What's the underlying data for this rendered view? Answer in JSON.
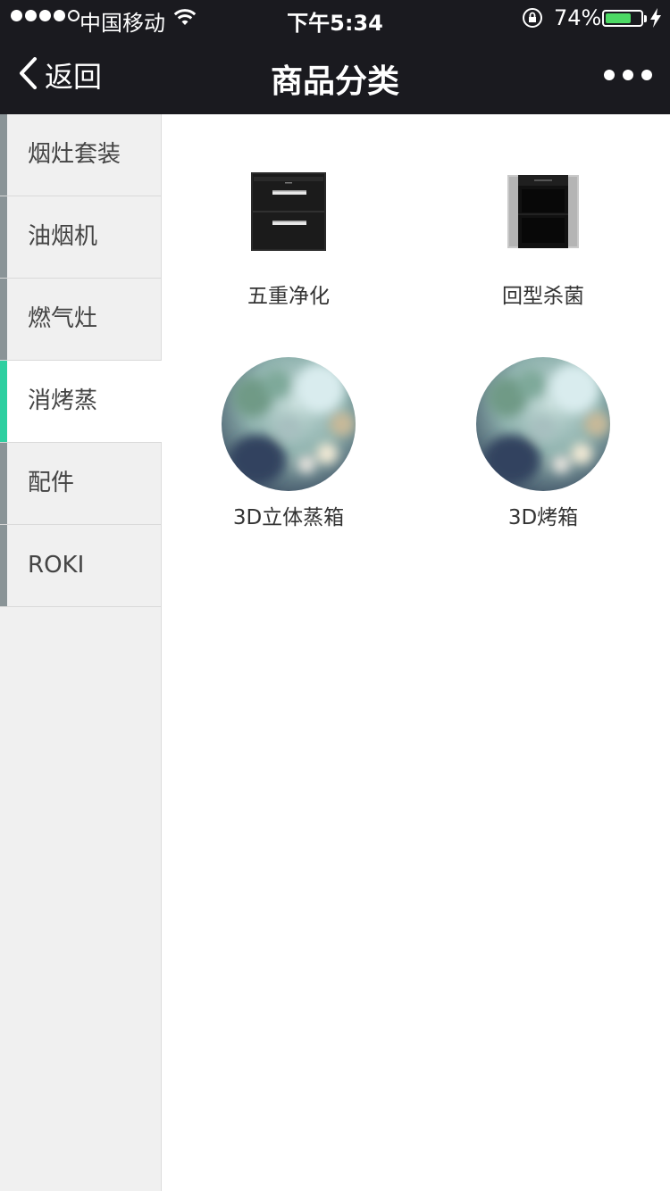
{
  "status_bar": {
    "carrier": "中国移动",
    "time": "下午5:34",
    "battery": "74%",
    "battery_level": 0.74
  },
  "nav": {
    "back_label": "返回",
    "title": "商品分类"
  },
  "sidebar": {
    "items": [
      {
        "label": "烟灶套装",
        "active": false
      },
      {
        "label": "油烟机",
        "active": false
      },
      {
        "label": "燃气灶",
        "active": false
      },
      {
        "label": "消烤蒸",
        "active": true
      },
      {
        "label": "配件",
        "active": false
      },
      {
        "label": "ROKI",
        "active": false
      }
    ]
  },
  "products": [
    {
      "name": "五重净化",
      "image": "disinfection-cabinet-two-drawer"
    },
    {
      "name": "回型杀菌",
      "image": "disinfection-cabinet-stainless"
    },
    {
      "name": "3D立体蒸箱",
      "image": "blurred-placeholder-circle"
    },
    {
      "name": "3D烤箱",
      "image": "blurred-placeholder-circle"
    }
  ],
  "colors": {
    "topbar": "#1a1a1f",
    "active_marker": "#2ecfa0",
    "inactive_marker": "#8a9497",
    "battery_fill": "#4cd964"
  }
}
